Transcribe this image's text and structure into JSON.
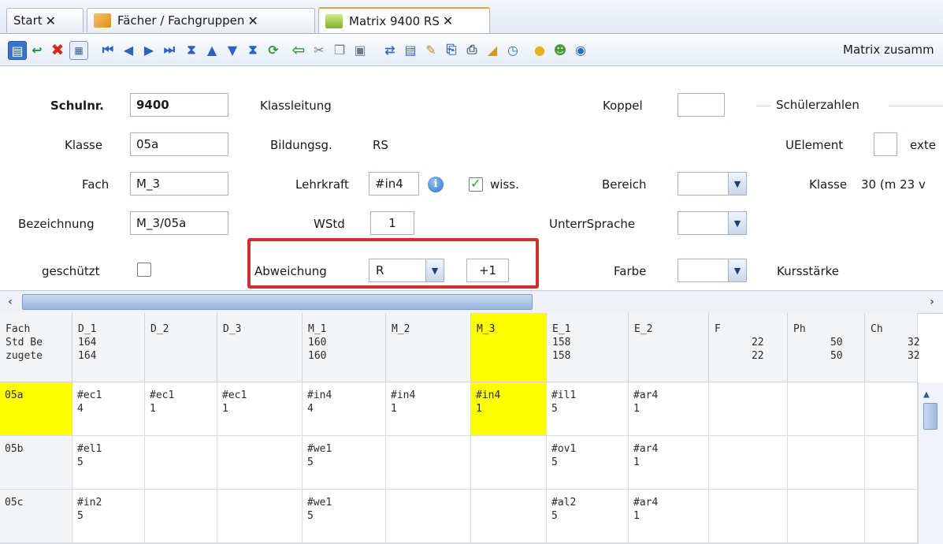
{
  "tabs": [
    {
      "label": "Start",
      "close": "✕"
    },
    {
      "label": "Fächer / Fachgruppen",
      "close": "✕"
    },
    {
      "label": "Matrix 9400 RS",
      "close": "✕"
    }
  ],
  "toolbar": {
    "icons": [
      "save-icon",
      "undo-icon",
      "delete-icon",
      "table-edit-icon",
      "first-icon",
      "prev-icon",
      "next-icon",
      "last-icon",
      "sort-top-icon",
      "move-up-icon",
      "move-down-icon",
      "sort-bottom-icon",
      "refresh-icon",
      "back-arrow-icon",
      "cut-icon",
      "copy-icon",
      "paste-icon",
      "transfer-icon",
      "report-icon",
      "notes-icon",
      "export-icon",
      "print-icon",
      "clean-icon",
      "clock-icon",
      "bulb-icon",
      "people-icon",
      "help-icon"
    ],
    "text": "Matrix zusamm"
  },
  "form": {
    "schulnr_label": "Schulnr.",
    "schulnr_value": "9400",
    "klassleitung_label": "Klassleitung",
    "koppel_label": "Koppel",
    "schuelerzahlen_label": "Schülerzahlen",
    "klasse_label": "Klasse",
    "klasse_value": "05a",
    "bildungsg_label": "Bildungsg.",
    "bildungsg_value": "RS",
    "uelement_label": "UElement",
    "ext_label": "exte",
    "fach_label": "Fach",
    "fach_value": "M_3",
    "lehrkraft_label": "Lehrkraft",
    "lehrkraft_value": "#in4",
    "wiss_label": "wiss.",
    "bereich_label": "Bereich",
    "klasse2_label": "Klasse",
    "klasse2_value": "30 (m 23 v",
    "bezeichnung_label": "Bezeichnung",
    "bezeichnung_value": "M_3/05a",
    "wstd_label": "WStd",
    "wstd_value": "1",
    "unterrsprache_label": "UnterrSprache",
    "geschuetzt_label": "geschützt",
    "abweichung_label": "Abweichung",
    "abweichung_value": "R",
    "abweichung_delta": "+1",
    "farbe_label": "Farbe",
    "kursstaerke_label": "Kursstärke"
  },
  "grid": {
    "corner": "Fach\nStd Be\nzugete",
    "columns": [
      {
        "name": "D_1",
        "std": "164",
        "zug": "164"
      },
      {
        "name": "D_2",
        "std": "",
        "zug": ""
      },
      {
        "name": "D_3",
        "std": "",
        "zug": ""
      },
      {
        "name": "M_1",
        "std": "160",
        "zug": "160"
      },
      {
        "name": "M_2",
        "std": "",
        "zug": ""
      },
      {
        "name": "M_3",
        "std": "",
        "zug": ""
      },
      {
        "name": "E_1",
        "std": "158",
        "zug": "158"
      },
      {
        "name": "E_2",
        "std": "",
        "zug": ""
      },
      {
        "name": "F",
        "std": "22",
        "zug": "22"
      },
      {
        "name": "Ph",
        "std": "50",
        "zug": "50"
      },
      {
        "name": "Ch",
        "std": "32",
        "zug": "32"
      }
    ],
    "rows": [
      {
        "klasse": "05a",
        "cells": [
          "#ec1\n4",
          "#ec1\n1",
          "#ec1\n1",
          "#in4\n4",
          "#in4\n1",
          "#in4\n1",
          "#il1\n5",
          "#ar4\n1",
          "",
          "",
          ""
        ]
      },
      {
        "klasse": "05b",
        "cells": [
          "#el1\n5",
          "",
          "",
          "#we1\n5",
          "",
          "",
          "#ov1\n5",
          "#ar4\n1",
          "",
          "",
          ""
        ]
      },
      {
        "klasse": "05c",
        "cells": [
          "#in2\n5",
          "",
          "",
          "#we1\n5",
          "",
          "",
          "#al2\n5",
          "#ar4\n1",
          "",
          "",
          ""
        ]
      }
    ]
  }
}
